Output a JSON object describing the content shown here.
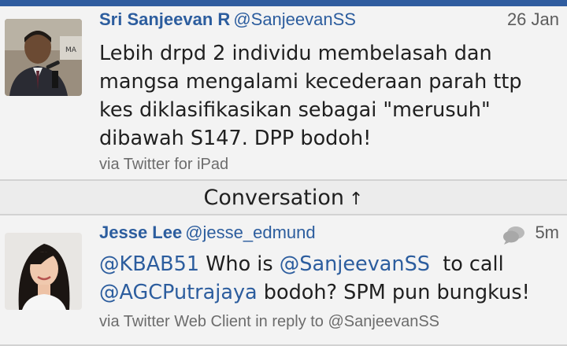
{
  "colors": {
    "accent": "#2c5d9e",
    "topbar": "#2f5c9f",
    "meta": "#6c6c6c"
  },
  "tweets": [
    {
      "name": "Sri Sanjeevan R",
      "handle": "@SanjeevanSS",
      "time": "26 Jan",
      "text": "Lebih drpd 2 individu membelasah dan mangsa mengalami kecederaan parah ttp kes diklasifikasikan sebagai \"merusuh\" dibawah S147. DPP bodoh!",
      "via": "via Twitter for iPad"
    },
    {
      "name": "Jesse Lee",
      "handle": "@jesse_edmund",
      "time": "5m",
      "text_parts": [
        {
          "text": "@KBAB51",
          "mention": true
        },
        {
          "text": " Who is ",
          "mention": false
        },
        {
          "text": "@SanjeevanSS",
          "mention": true
        },
        {
          "text": "  to call ",
          "mention": false
        },
        {
          "text": "@AGCPutrajaya",
          "mention": true
        },
        {
          "text": " bodoh? SPM pun bungkus!",
          "mention": false
        }
      ],
      "via": "via Twitter Web Client in reply to @SanjeevanSS",
      "reply_icon": "speech-bubbles-icon"
    }
  ],
  "conversation": {
    "label": "Conversation",
    "arrow": "↑"
  }
}
